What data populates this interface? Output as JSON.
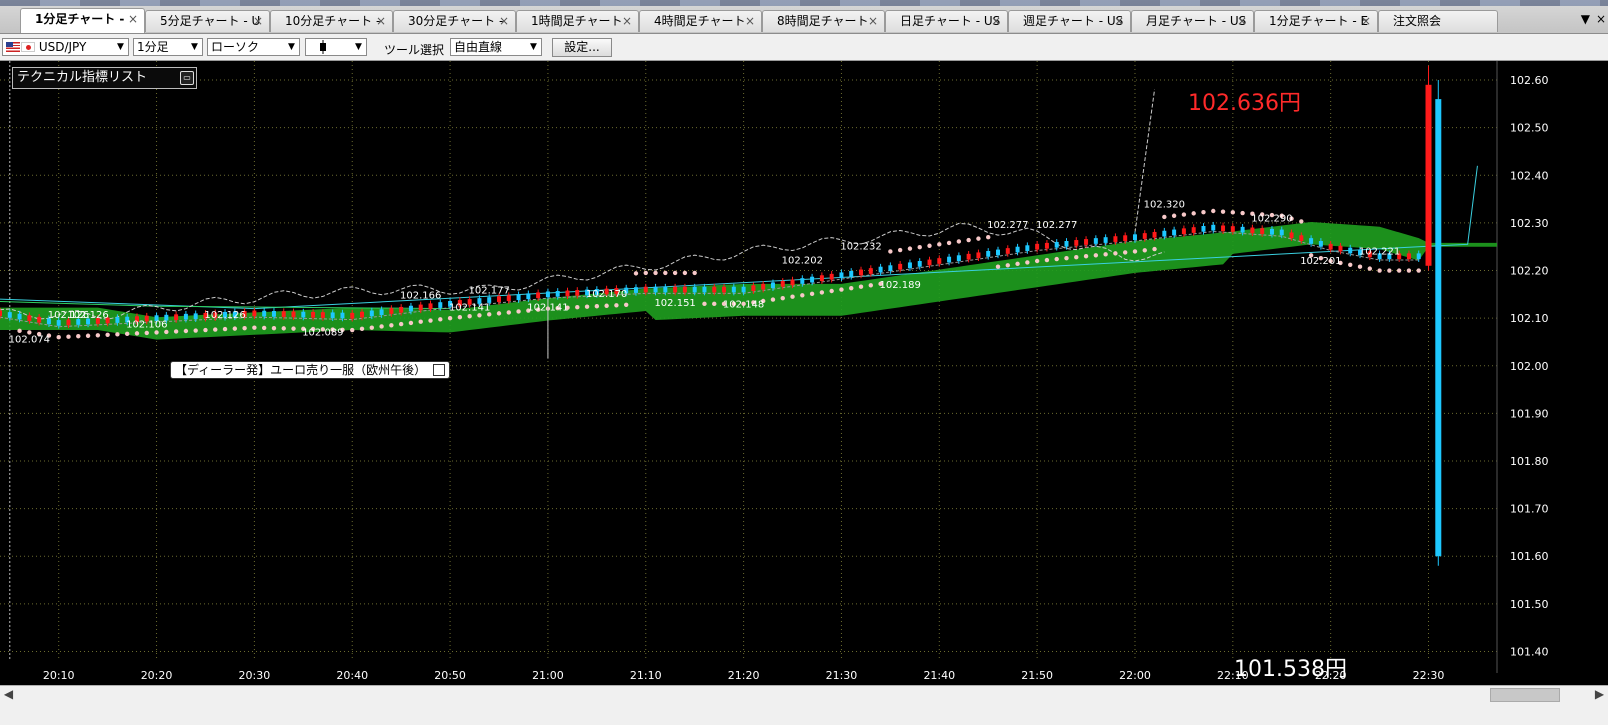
{
  "tabs": [
    {
      "label": "1分足チャート -",
      "active": true
    },
    {
      "label": "5分足チャート - U",
      "active": false
    },
    {
      "label": "10分足チャート -",
      "active": false
    },
    {
      "label": "30分足チャート -",
      "active": false
    },
    {
      "label": "1時間足チャート",
      "active": false
    },
    {
      "label": "4時間足チャート",
      "active": false
    },
    {
      "label": "8時間足チャート",
      "active": false
    },
    {
      "label": "日足チャート - US",
      "active": false
    },
    {
      "label": "週足チャート - US",
      "active": false
    },
    {
      "label": "月足チャート - US",
      "active": false
    },
    {
      "label": "1分足チャート - E",
      "active": false
    },
    {
      "label": "注文照会",
      "active": false
    }
  ],
  "tab_close_glyph": "×",
  "tab_menu_glyph": "▼",
  "toolbar": {
    "symbol": "USD/JPY",
    "timeframe": "1分足",
    "chart_type": "ローソク",
    "candle_icon": "candle-icon",
    "tool_label": "ツール選択",
    "tool_value": "自由直線",
    "settings_label": "設定..."
  },
  "indicator_panel": {
    "label": "テクニカル指標リスト"
  },
  "news": {
    "text": "【ディーラー発】ユーロ売り一服（欧州午後）"
  },
  "price_labels": {
    "high": "102.636円",
    "low": "101.538円"
  },
  "colors": {
    "background": "#000000",
    "up": "#ff1a1a",
    "down": "#1ec8ff",
    "cloud": "#1fa01f",
    "parabolic": "#f7c8c8",
    "lagging": "#cccccc",
    "grid": "#6b6b2f",
    "high_label": "#ff2a2a"
  },
  "chart_data": {
    "type": "candlestick",
    "grid": true,
    "x_ticks": [
      "20:10",
      "20:20",
      "20:30",
      "20:40",
      "20:50",
      "21:00",
      "21:10",
      "21:20",
      "21:30",
      "21:40",
      "21:50",
      "22:00",
      "22:10",
      "22:20",
      "22:30"
    ],
    "y_ticks": [
      "102.60",
      "102.50",
      "102.40",
      "102.30",
      "102.20",
      "102.10",
      "102.00",
      "101.90",
      "101.80",
      "101.70",
      "101.60",
      "101.50",
      "101.40"
    ],
    "ylim": [
      101.38,
      102.64
    ],
    "xlim_minutes": [
      -6,
      147
    ],
    "x_start": "20:10",
    "annotations": [
      {
        "text": "102.074",
        "minute": -3,
        "price": 102.074
      },
      {
        "text": "102.126",
        "minute": 3,
        "price": 102.126
      },
      {
        "text": "102.126",
        "minute": 1,
        "price": 102.126
      },
      {
        "text": "102.106",
        "minute": 9,
        "price": 102.106
      },
      {
        "text": "102.126",
        "minute": 17,
        "price": 102.126
      },
      {
        "text": "102.089",
        "minute": 27,
        "price": 102.089
      },
      {
        "text": "102.166",
        "minute": 37,
        "price": 102.166
      },
      {
        "text": "102.177",
        "minute": 44,
        "price": 102.177
      },
      {
        "text": "102.141",
        "minute": 42,
        "price": 102.141
      },
      {
        "text": "102.141",
        "minute": 50,
        "price": 102.141
      },
      {
        "text": "102.170",
        "minute": 56,
        "price": 102.17
      },
      {
        "text": "102.151",
        "minute": 63,
        "price": 102.151
      },
      {
        "text": "102.148",
        "minute": 70,
        "price": 102.148
      },
      {
        "text": "102.202",
        "minute": 76,
        "price": 102.202
      },
      {
        "text": "102.232",
        "minute": 82,
        "price": 102.232
      },
      {
        "text": "102.189",
        "minute": 86,
        "price": 102.189
      },
      {
        "text": "102.277",
        "minute": 97,
        "price": 102.277
      },
      {
        "text": "102.277",
        "minute": 102,
        "price": 102.277
      },
      {
        "text": "102.320",
        "minute": 113,
        "price": 102.32
      },
      {
        "text": "102.290",
        "minute": 124,
        "price": 102.29
      },
      {
        "text": "102.201",
        "minute": 129,
        "price": 102.201
      },
      {
        "text": "102.221",
        "minute": 135,
        "price": 102.221
      }
    ],
    "candles": [
      {
        "minute": 140,
        "open": 102.21,
        "high": 102.63,
        "low": 102.2,
        "close": 102.59
      },
      {
        "minute": 141,
        "open": 102.56,
        "high": 102.6,
        "low": 101.58,
        "close": 101.6
      }
    ]
  }
}
